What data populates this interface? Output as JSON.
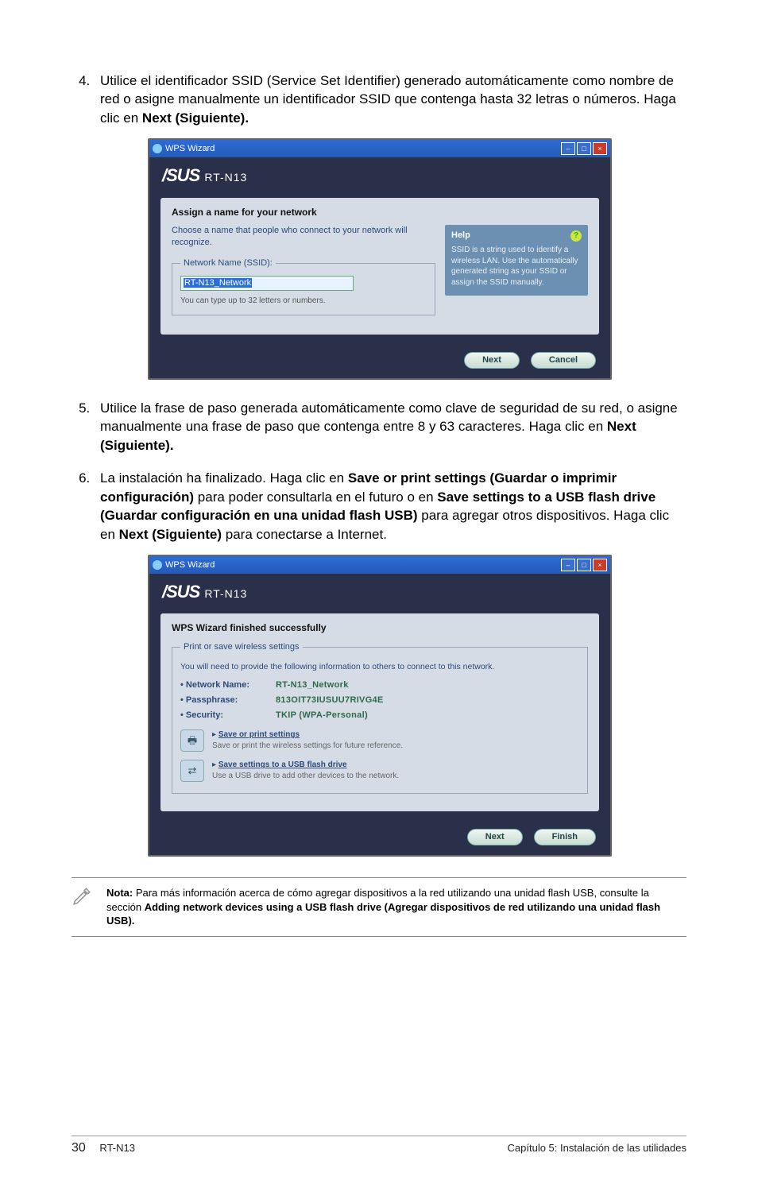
{
  "instructions": {
    "item4": {
      "number": "4.",
      "text_pre": "Utilice el identificador SSID (Service Set Identifier) generado automáticamente como nombre de red o asigne manualmente un identificador SSID que contenga hasta 32 letras o números. Haga clic en ",
      "text_bold": "Next (Siguiente)."
    },
    "item5": {
      "number": "5.",
      "text_pre": "Utilice la frase de paso generada automáticamente como clave de seguridad de su red, o asigne manualmente una frase de paso que contenga entre 8 y 63 caracteres. Haga clic en ",
      "text_bold": "Next (Siguiente)."
    },
    "item6": {
      "number": "6.",
      "seg1": "La instalación ha finalizado. Haga clic en ",
      "bold1": "Save or print settings (Guardar o imprimir configuración)",
      "seg2": " para poder consultarla en el futuro o en ",
      "bold2": "Save settings to a USB flash drive (Guardar configuración en una unidad flash USB)",
      "seg3": " para agregar otros dispositivos. Haga clic en ",
      "bold3": "Next (Siguiente)",
      "seg4": " para conectarse a Internet."
    }
  },
  "wizard": {
    "title": "WPS Wizard",
    "brand_logo": "/SUS",
    "model": "RT-N13"
  },
  "shot1": {
    "panel_title": "Assign a name for your network",
    "panel_desc": "Choose a name that people who connect to your network will recognize.",
    "fieldset_legend": "Network Name (SSID):",
    "ssid_value_sel": "RT-N13_Network",
    "hint": "You can type up to 32 letters or numbers.",
    "help_header": "Help",
    "help_text": "SSID is a string used to identify a wireless LAN. Use the automatically generated string as your SSID or assign the SSID manually.",
    "btn_next": "Next",
    "btn_cancel": "Cancel"
  },
  "shot2": {
    "panel_title": "WPS Wizard finished successfully",
    "fieldset_legend": "Print or save wireless settings",
    "fieldset_desc": "You will need to provide the following information to others to connect to this network.",
    "rows": {
      "network_name_k": "• Network Name:",
      "network_name_v": "RT-N13_Network",
      "passphrase_k": "• Passphrase:",
      "passphrase_v": "813OIT73IUSUU7RIVG4E",
      "security_k": "• Security:",
      "security_v": "TKIP (WPA-Personal)"
    },
    "action1_link": "Save or print settings",
    "action1_desc": "Save or print the wireless settings for future reference.",
    "action2_link": "Save settings to a USB flash drive",
    "action2_desc": "Use a USB drive to add other devices to the network.",
    "btn_next": "Next",
    "btn_finish": "Finish"
  },
  "note": {
    "bold_lead": "Nota:",
    "seg1": " Para más información acerca de cómo agregar dispositivos a la red utilizando una unidad flash USB, consulte la sección ",
    "bold_ref": "Adding network devices using a USB flash drive (Agregar dispositivos de red utilizando una unidad flash USB)."
  },
  "footer": {
    "page": "30",
    "left": "RT-N13",
    "right": "Capítulo 5: Instalación de las utilidades"
  }
}
